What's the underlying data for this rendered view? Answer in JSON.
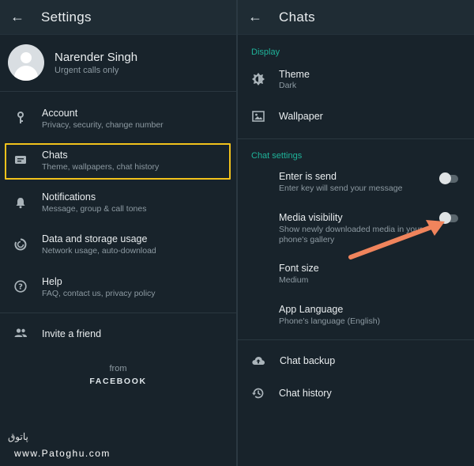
{
  "left": {
    "title": "Settings",
    "profile": {
      "name": "Narender Singh",
      "status": "Urgent calls only"
    },
    "items": [
      {
        "title": "Account",
        "sub": "Privacy, security, change number",
        "icon": "key-icon"
      },
      {
        "title": "Chats",
        "sub": "Theme, wallpapers, chat history",
        "icon": "chat-icon"
      },
      {
        "title": "Notifications",
        "sub": "Message, group & call tones",
        "icon": "bell-icon"
      },
      {
        "title": "Data and storage usage",
        "sub": "Network usage, auto-download",
        "icon": "data-sync-icon"
      },
      {
        "title": "Help",
        "sub": "FAQ, contact us, privacy policy",
        "icon": "help-icon"
      }
    ],
    "invite": {
      "title": "Invite a friend",
      "icon": "people-icon"
    },
    "from": "from",
    "brand": "FACEBOOK",
    "highlight_color": "#f2c21b"
  },
  "right": {
    "title": "Chats",
    "display_section": "Display",
    "theme": {
      "title": "Theme",
      "sub": "Dark",
      "icon": "brightness-icon"
    },
    "wallpaper": {
      "title": "Wallpaper",
      "icon": "wallpaper-icon"
    },
    "chat_settings_section": "Chat settings",
    "enter_is_send": {
      "title": "Enter is send",
      "sub": "Enter key will send your message",
      "enabled": false
    },
    "media_visibility": {
      "title": "Media visibility",
      "sub": "Show newly downloaded media in your phone's gallery",
      "enabled": false
    },
    "font_size": {
      "title": "Font size",
      "sub": "Medium"
    },
    "app_language": {
      "title": "App Language",
      "sub": "Phone's language (English)"
    },
    "chat_backup": {
      "title": "Chat backup",
      "icon": "cloud-upload-icon"
    },
    "chat_history": {
      "title": "Chat history",
      "icon": "history-icon"
    },
    "accent_color": "#1fb39a",
    "arrow_color": "#f0845c"
  },
  "watermark": {
    "logo": "پاتوق",
    "url": "www.Patoghu.com"
  }
}
